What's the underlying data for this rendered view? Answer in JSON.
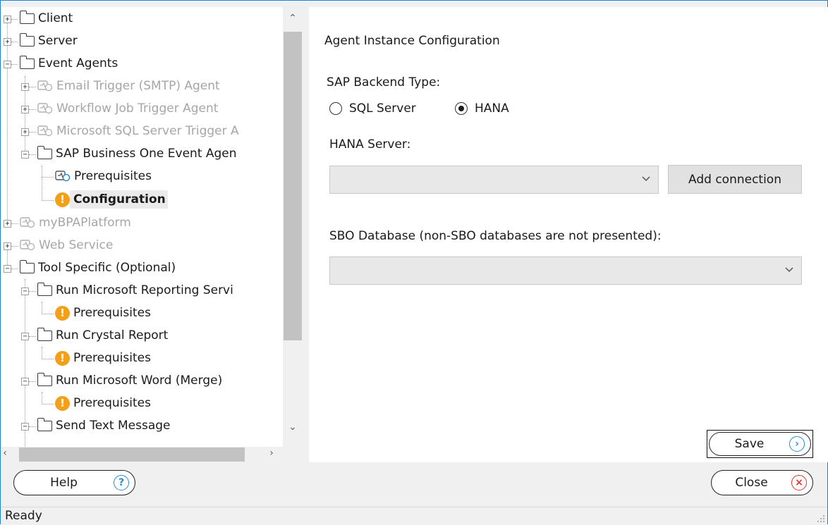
{
  "tree": {
    "items": [
      {
        "label": "Client",
        "icon": "folder-icon",
        "state": "normal"
      },
      {
        "label": "Server",
        "icon": "folder-icon",
        "state": "normal"
      },
      {
        "label": "Event Agents",
        "icon": "folder-icon",
        "state": "normal"
      },
      {
        "label": "Email Trigger (SMTP) Agent",
        "icon": "agent-icon",
        "state": "disabled"
      },
      {
        "label": "Workflow Job Trigger Agent",
        "icon": "agent-icon",
        "state": "disabled"
      },
      {
        "label": "Microsoft SQL Server Trigger A",
        "icon": "agent-icon",
        "state": "disabled"
      },
      {
        "label": "SAP Business One Event Agen",
        "icon": "folder-icon",
        "state": "normal"
      },
      {
        "label": "Prerequisites",
        "icon": "agent-icon",
        "state": "normal"
      },
      {
        "label": "Configuration",
        "icon": "warning-icon",
        "state": "selected"
      },
      {
        "label": "myBPAPlatform",
        "icon": "agent-icon",
        "state": "disabled"
      },
      {
        "label": "Web Service",
        "icon": "agent-icon",
        "state": "disabled"
      },
      {
        "label": "Tool Specific (Optional)",
        "icon": "folder-icon",
        "state": "normal"
      },
      {
        "label": "Run Microsoft Reporting Servi",
        "icon": "folder-icon",
        "state": "normal"
      },
      {
        "label": "Prerequisites",
        "icon": "warning-icon",
        "state": "normal"
      },
      {
        "label": "Run Crystal Report",
        "icon": "folder-icon",
        "state": "normal"
      },
      {
        "label": "Prerequisites",
        "icon": "warning-icon",
        "state": "normal"
      },
      {
        "label": "Run Microsoft Word (Merge)",
        "icon": "folder-icon",
        "state": "normal"
      },
      {
        "label": "Prerequisites",
        "icon": "warning-icon",
        "state": "normal"
      },
      {
        "label": "Send Text Message",
        "icon": "folder-icon",
        "state": "normal"
      }
    ]
  },
  "config": {
    "title": "Agent Instance Configuration",
    "backend_label": "SAP Backend Type:",
    "radio_sql": "SQL Server",
    "radio_hana": "HANA",
    "selected_backend": "HANA",
    "hana_server_label": "HANA Server:",
    "hana_server_value": "",
    "add_connection_label": "Add connection",
    "sbo_label": "SBO Database (non-SBO databases are not presented):",
    "sbo_value": ""
  },
  "buttons": {
    "save": "Save",
    "help": "Help",
    "close": "Close"
  },
  "status": {
    "text": "Ready"
  },
  "colors": {
    "warning": "#f2a01c",
    "help_icon": "#2a8bd6",
    "save_icon": "#2a8bd6",
    "close_icon": "#e0342f",
    "window_border": "#1883d7"
  }
}
